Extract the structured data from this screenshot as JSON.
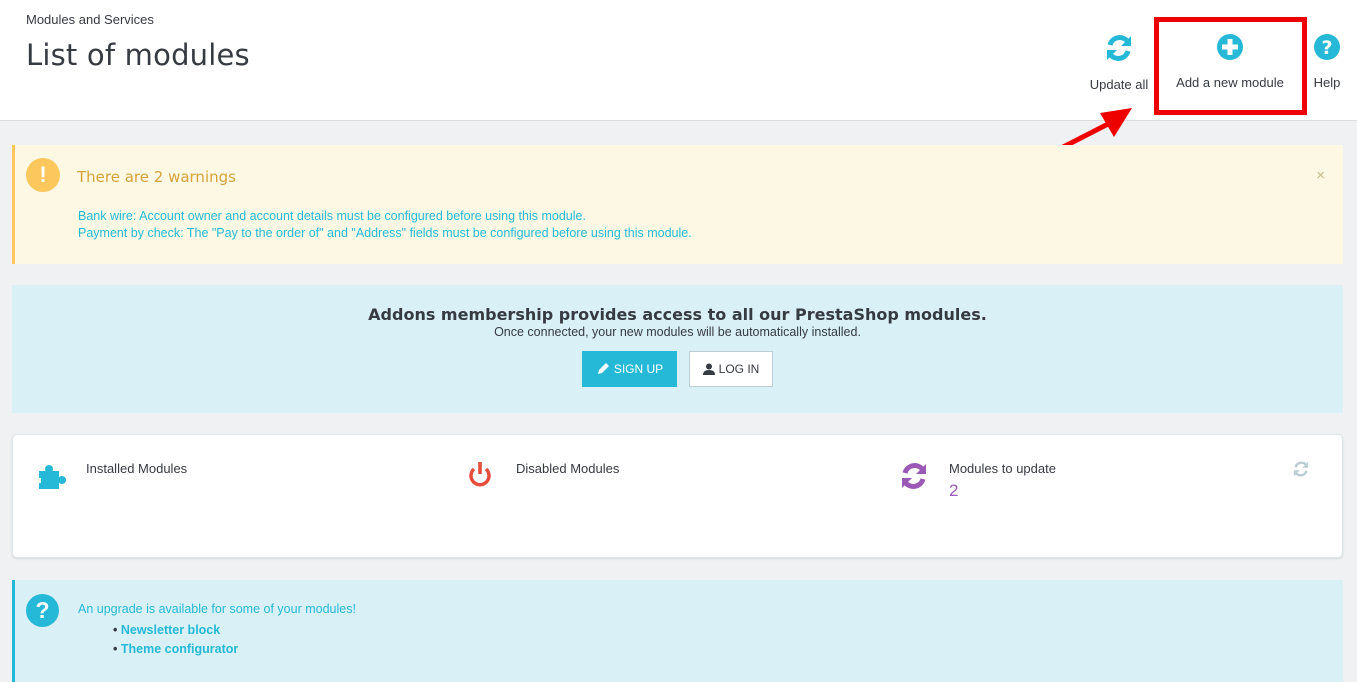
{
  "header": {
    "breadcrumb": "Modules and Services",
    "title": "List of modules",
    "toolbar": {
      "update_all": "Update all",
      "add_module": "Add a new module",
      "help": "Help"
    }
  },
  "warning": {
    "title": "There are 2 warnings",
    "close": "×",
    "items": [
      "Bank wire: Account owner and account details must be configured before using this module.",
      "Payment by check: The \"Pay to the order of\" and \"Address\" fields must be configured before using this module."
    ]
  },
  "addons": {
    "title": "Addons membership provides access to all our PrestaShop modules.",
    "subtitle": "Once connected, your new modules will be automatically installed.",
    "signup": "SIGN UP",
    "login": "LOG IN"
  },
  "stats": {
    "installed_label": "Installed Modules",
    "disabled_label": "Disabled Modules",
    "update_label": "Modules to update",
    "update_count": "2"
  },
  "upgrade": {
    "title": "An upgrade is available for some of your modules!",
    "items": [
      "Newsletter block",
      "Theme configurator"
    ]
  },
  "colors": {
    "accent": "#25b9d7",
    "warning": "#fcc85d",
    "danger": "#e74c3c",
    "purple": "#9b59b6",
    "highlight": "#ee0000"
  }
}
